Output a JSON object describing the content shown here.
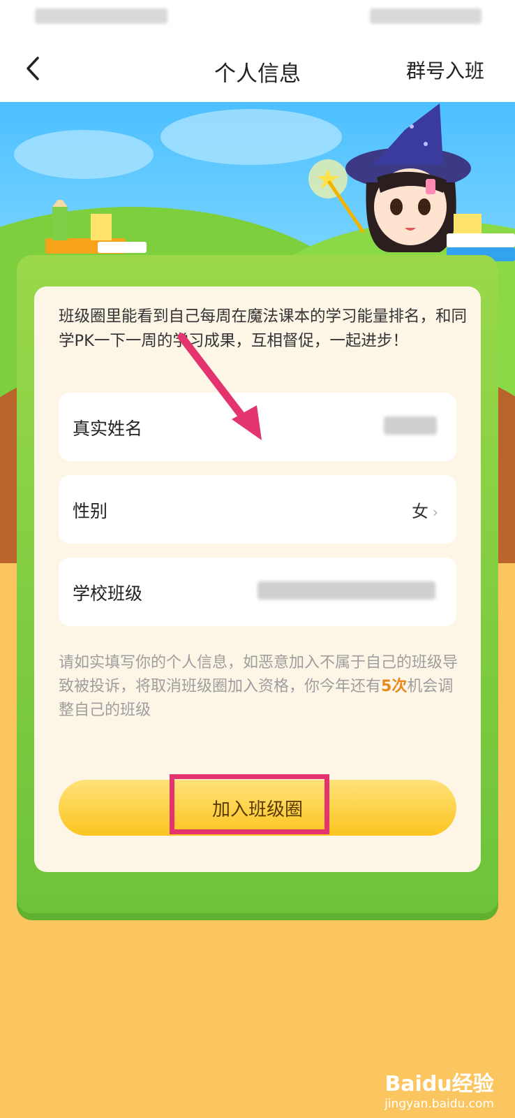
{
  "nav": {
    "title": "个人信息",
    "right_action": "群号入班"
  },
  "intro_text": "班级圈里能看到自己每周在魔法课本的学习能量排名，和同学PK一下一周的学习成果，互相督促，一起进步！",
  "fields": [
    {
      "label": "真实姓名",
      "value": ""
    },
    {
      "label": "性别",
      "value": "女"
    },
    {
      "label": "学校班级",
      "value": ""
    }
  ],
  "notice": {
    "before": "请如实填写你的个人信息，如恶意加入不属于自己的班级导致被投诉，将取消班级圈加入资格，你今年还有",
    "count": "5次",
    "after": "机会调整自己的班级"
  },
  "join_button": "加入班级圈",
  "watermark": {
    "logo": "Baidu经验",
    "url": "jingyan.baidu.com"
  },
  "colors": {
    "accent_pink": "#e4346f",
    "button_yellow": "#fcc51f",
    "highlight_orange": "#e58a1d",
    "card_green": "#7ccb3f"
  }
}
